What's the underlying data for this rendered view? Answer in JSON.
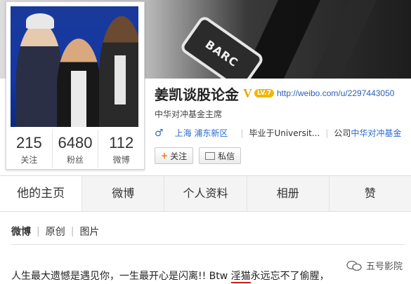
{
  "banner": {
    "tag_text": "BARC"
  },
  "profile": {
    "stats": [
      {
        "value": "215",
        "label": "关注"
      },
      {
        "value": "6480",
        "label": "粉丝"
      },
      {
        "value": "112",
        "label": "微博"
      }
    ]
  },
  "info": {
    "name": "姜凯谈股论金",
    "v_badge": "V",
    "level": "LV.7",
    "url": "http://weibo.com/u/2297443050",
    "description": "中华对冲基金主席",
    "gender_symbol": "♂",
    "location": "上海 浦东新区",
    "education": "毕业于Universit...",
    "company_prefix": "公司",
    "company": "中华对冲基金",
    "follow_button": "关注",
    "message_button": "私信"
  },
  "tabs": [
    "他的主页",
    "微博",
    "个人资料",
    "相册",
    "赞"
  ],
  "subnav": [
    "微博",
    "原创",
    "图片"
  ],
  "post": {
    "text_before": "人生最大遗憾是遇见你，一生最开心是闪离!! Btw ",
    "underlined": "淫猫",
    "text_after": "永远忘不了偷腥，"
  },
  "watermark": {
    "label": "五号影院"
  },
  "colors": {
    "link": "#2b6ad0",
    "vbadge": "#e6a800",
    "underline": "#d12020"
  }
}
